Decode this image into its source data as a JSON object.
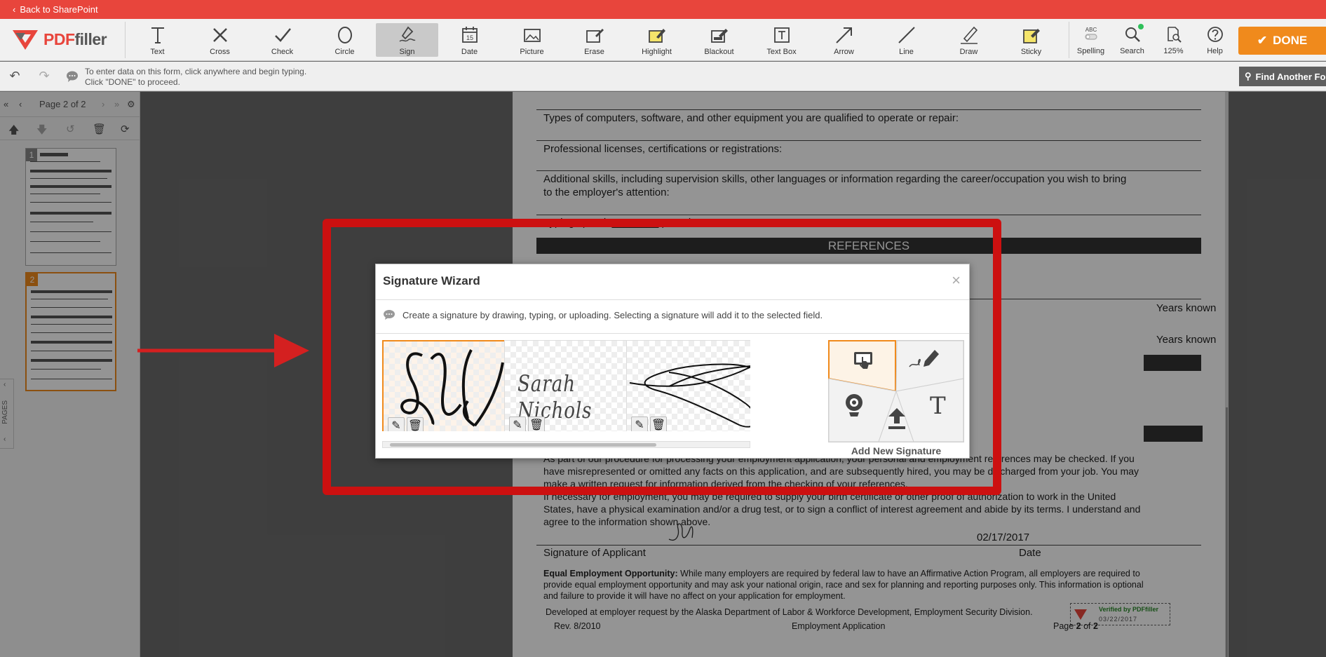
{
  "topbar": {
    "back_label": "Back to SharePoint"
  },
  "brand": {
    "logo_text_red": "PDF",
    "logo_text_grey": "filler"
  },
  "toolbar": {
    "tools": [
      {
        "label": "Text",
        "icon": "text-icon"
      },
      {
        "label": "Cross",
        "icon": "cross-icon"
      },
      {
        "label": "Check",
        "icon": "check-icon"
      },
      {
        "label": "Circle",
        "icon": "circle-icon"
      },
      {
        "label": "Sign",
        "icon": "sign-icon",
        "active": true
      },
      {
        "label": "Date",
        "icon": "date-icon"
      },
      {
        "label": "Picture",
        "icon": "picture-icon"
      },
      {
        "label": "Erase",
        "icon": "erase-icon"
      },
      {
        "label": "Highlight",
        "icon": "highlight-icon"
      },
      {
        "label": "Blackout",
        "icon": "blackout-icon"
      },
      {
        "label": "Text Box",
        "icon": "textbox-icon"
      },
      {
        "label": "Arrow",
        "icon": "arrow-icon"
      },
      {
        "label": "Line",
        "icon": "line-icon"
      },
      {
        "label": "Draw",
        "icon": "draw-icon"
      },
      {
        "label": "Sticky",
        "icon": "sticky-icon"
      }
    ],
    "right_tools": [
      {
        "label": "Spelling",
        "icon": "spelling-icon"
      },
      {
        "label": "Search",
        "icon": "search-icon"
      },
      {
        "label": "125%",
        "icon": "zoom-icon"
      },
      {
        "label": "Help",
        "icon": "help-icon"
      }
    ],
    "spelling_badge": "ABC",
    "date_badge": "15",
    "done_label": "DONE"
  },
  "subbar": {
    "hint_line1": "To enter data on this form, click anywhere and begin typing.",
    "hint_line2": "Click \"DONE\" to proceed.",
    "find_label": "Find Another Form"
  },
  "pages": {
    "indicator": "Page 2 of 2",
    "tab_label": "PAGES",
    "thumbs": [
      {
        "num": "1"
      },
      {
        "num": "2"
      }
    ]
  },
  "document": {
    "q_computers": "Types of computers, software, and other equipment you are qualified to operate or repair:",
    "q_licenses": "Professional licenses, certifications or registrations:",
    "q_skills_1": "Additional skills, including supervision skills, other languages or information regarding the career/occupation you wish to bring",
    "q_skills_2": "to the employer's attention:",
    "typing_speed": "Typing speed: ________ per minute",
    "references_header": "REFERENCES",
    "years_known_1": "Years known",
    "years_known_2": "Years known",
    "para1_1": "As part of our procedure for processing your employment application, your personal and employment references may be checked. If you",
    "para1_2": "have misrepresented or omitted any facts on this application, and are subsequently hired, you may be discharged from your job. You may",
    "para1_3": "make a written request for information derived from the checking of your references.",
    "para2_1": "If necessary for employment, you may be required to supply your birth certificate or other proof of authorization to work in the United",
    "para2_2": "States, have a physical examination and/or a drug test, or to sign a conflict of interest agreement and abide by its terms. I understand and",
    "para2_3": "agree to the information shown above.",
    "date_value": "02/17/2017",
    "sig_label": "Signature of Applicant",
    "date_label": "Date",
    "eeo_bold": "Equal Employment Opportunity:",
    "eeo_1": " While many employers are required by federal law to have an Affirmative Action Program, all employers are required to",
    "eeo_2": "provide equal employment opportunity and may ask your national origin, race and sex for planning and reporting purposes only. This information is optional",
    "eeo_3": "and failure to provide it will have no affect on your application for employment.",
    "developed": "Developed at employer request by the Alaska Department of Labor & Workforce Development, Employment Security Division.",
    "rev": "Rev. 8/2010",
    "footer_title": "Employment Application",
    "footer_page_pre": "Page ",
    "footer_page_num": "2",
    "footer_page_mid": " of ",
    "footer_page_total": "2",
    "stamp_verified": "Verified by PDFfiller",
    "stamp_date": "03/22/2017"
  },
  "signature_wizard": {
    "title": "Signature Wizard",
    "description": "Create a signature by drawing, typing, or uploading. Selecting a signature will add it to the selected field.",
    "typed_signature": "Sarah Nichols",
    "add_new_label": "Add New Signature",
    "options": [
      {
        "icon": "touch-draw-icon"
      },
      {
        "icon": "pen-sign-icon"
      },
      {
        "icon": "webcam-icon"
      },
      {
        "icon": "upload-icon"
      },
      {
        "icon": "type-text-icon",
        "glyph": "T"
      }
    ]
  },
  "colors": {
    "topbar": "#e8453c",
    "done": "#f08a1c",
    "highlight_box": "#cc1010",
    "selected_sig": "#f08a1c"
  }
}
